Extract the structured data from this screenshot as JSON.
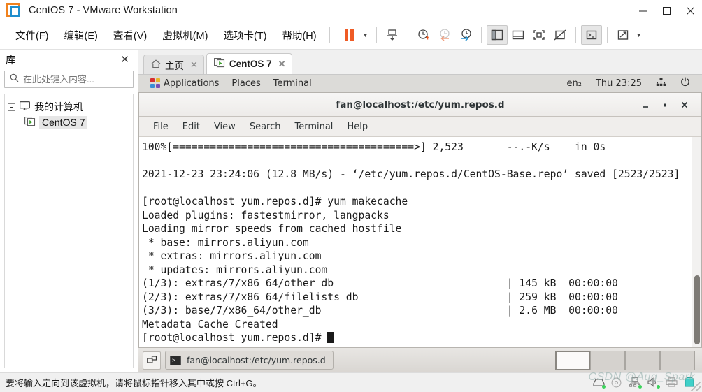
{
  "window": {
    "title": "CentOS 7 - VMware Workstation",
    "controls": {
      "minimize": "minimize-icon",
      "maximize": "maximize-icon",
      "close": "close-icon"
    }
  },
  "menubar": {
    "items": [
      {
        "label": "文件(F)",
        "accel": "F"
      },
      {
        "label": "编辑(E)",
        "accel": "E"
      },
      {
        "label": "查看(V)",
        "accel": "V"
      },
      {
        "label": "虚拟机(M)",
        "accel": "M"
      },
      {
        "label": "选项卡(T)",
        "accel": "T"
      },
      {
        "label": "帮助(H)",
        "accel": "H"
      }
    ]
  },
  "toolbar": {
    "buttons": [
      {
        "name": "suspend-button",
        "icon": "pause-icon"
      },
      {
        "name": "power-dropdown",
        "icon": "chevron-down-icon"
      },
      {
        "name": "snapshot-take-button",
        "icon": "snapshot-save-icon"
      },
      {
        "name": "snapshot-manager-button",
        "icon": "clock-plus-icon"
      },
      {
        "name": "revert-snapshot-button",
        "icon": "clock-back-icon"
      },
      {
        "name": "manage-snapshots-button",
        "icon": "clock-wrench-icon"
      },
      {
        "name": "show-library-button",
        "icon": "sidebar-panel-icon"
      },
      {
        "name": "show-thumbnail-bar-button",
        "icon": "bottom-panel-icon"
      },
      {
        "name": "fullscreen-button",
        "icon": "fullscreen-icon"
      },
      {
        "name": "unity-mode-button",
        "icon": "unity-off-icon"
      },
      {
        "name": "console-view-button",
        "icon": "terminal-prompt-icon"
      },
      {
        "name": "stretch-view-button",
        "icon": "expand-arrows-icon"
      },
      {
        "name": "view-dropdown",
        "icon": "chevron-down-icon"
      }
    ]
  },
  "library": {
    "title": "库",
    "close_label": "✕",
    "search": {
      "placeholder": "在此处键入内容...",
      "value": "",
      "icon": "search-icon"
    },
    "tree": [
      {
        "label": "我的计算机",
        "icon": "monitor-icon",
        "level": 0,
        "expanded": true,
        "selected": false
      },
      {
        "label": "CentOS 7",
        "icon": "vm-running-icon",
        "level": 1,
        "expanded": false,
        "selected": true
      }
    ]
  },
  "tabs": [
    {
      "label": "主页",
      "icon": "home-icon",
      "active": false,
      "close": "✕"
    },
    {
      "label": "CentOS 7",
      "icon": "vm-running-icon",
      "active": true,
      "close": "✕"
    }
  ],
  "guest": {
    "top_bar": {
      "apps_label": "Applications",
      "places_label": "Places",
      "app_label": "Terminal",
      "keyboard_layout": "en₂",
      "clock": "Thu 23:25",
      "network_icon": "network-wired-icon",
      "power_icon": "power-icon"
    },
    "terminal_window": {
      "title": "fan@localhost:/etc/yum.repos.d",
      "menu": [
        "File",
        "Edit",
        "View",
        "Search",
        "Terminal",
        "Help"
      ],
      "buttons": {
        "minimize": "minimize-icon",
        "maximize": "maximize-icon",
        "close": "close-icon"
      },
      "content": "100%[=======================================>] 2,523       --.-K/s    in 0s\n\n2021-12-23 23:24:06 (12.8 MB/s) - ‘/etc/yum.repos.d/CentOS-Base.repo’ saved [2523/2523]\n\n[root@localhost yum.repos.d]# yum makecache\nLoaded plugins: fastestmirror, langpacks\nLoading mirror speeds from cached hostfile\n * base: mirrors.aliyun.com\n * extras: mirrors.aliyun.com\n * updates: mirrors.aliyun.com\n(1/3): extras/7/x86_64/other_db                            | 145 kB  00:00:00\n(2/3): extras/7/x86_64/filelists_db                        | 259 kB  00:00:00\n(3/3): base/7/x86_64/other_db                              | 2.6 MB  00:00:00\nMetadata Cache Created\n[root@localhost yum.repos.d]# "
    },
    "bottom_bar": {
      "show_desktop_icon": "show-desktop-icon",
      "task_label": "fan@localhost:/etc/yum.repos.d",
      "task_icon": "terminal-icon",
      "workspaces": [
        {
          "active": true
        },
        {
          "active": false
        },
        {
          "active": false
        },
        {
          "active": false
        }
      ]
    }
  },
  "statusbar": {
    "message": "要将输入定向到该虚拟机，请将鼠标指针移入其中或按 Ctrl+G。",
    "icons": [
      "hard-disk-icon",
      "cd-dvd-icon",
      "network-adapter-icon",
      "sound-card-icon",
      "printer-icon",
      "usb-icon"
    ],
    "watermark": "CSDN @Aug_Spark"
  },
  "colors": {
    "accent_orange": "#ef5b25",
    "accent_blue": "#1f8ecd",
    "vm_running_green": "#3a9e28",
    "titlebar_bg": "#ffffff",
    "app_bg": "#f0f0f0",
    "terminal_bg": "#ffffff",
    "gnome_bar_bg": "#dcdbd8"
  }
}
